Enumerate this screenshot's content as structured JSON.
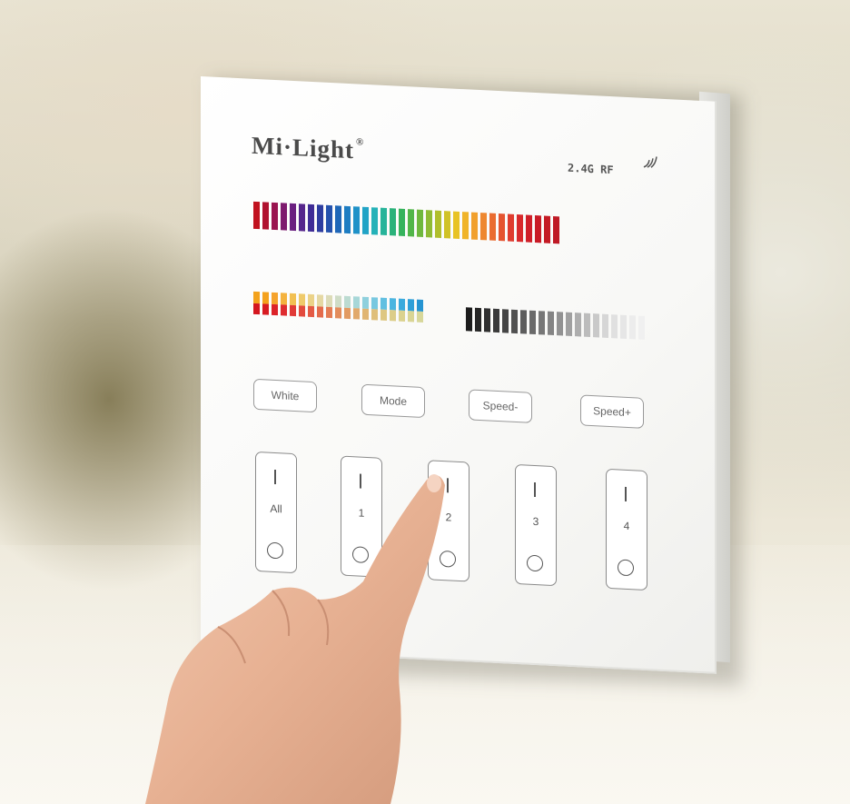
{
  "brand": {
    "name": "Mi·Light",
    "registered": "®"
  },
  "rf_label": "2.4G RF",
  "icons": {
    "rf": "wifi-signal-icon",
    "off": "circle-icon",
    "on": "bar-icon"
  },
  "rainbow_colors": [
    "#c1121f",
    "#b0122f",
    "#9a1450",
    "#7e1a6e",
    "#6a1f80",
    "#55258c",
    "#3f2c96",
    "#2e3da0",
    "#2552ad",
    "#1f67b8",
    "#1e7dc2",
    "#1f92c8",
    "#22a4c6",
    "#25b2b8",
    "#27b49a",
    "#2ab27a",
    "#35b35c",
    "#52b649",
    "#6fb83e",
    "#8fbb35",
    "#b0be2c",
    "#d0c226",
    "#e8c324",
    "#f0b42a",
    "#f1a02d",
    "#ee872f",
    "#ea6c30",
    "#e55430",
    "#df3c2f",
    "#d8292c",
    "#cf1f29",
    "#c91b26",
    "#c41a24",
    "#bf1a25"
  ],
  "warm_top": [
    "#f3a21b",
    "#f4a11d",
    "#f5a32c",
    "#f4b23e",
    "#f2c052",
    "#efca6a",
    "#ebd287",
    "#e5d8a3",
    "#dcdbb7",
    "#cfdcc6",
    "#bcdbd1",
    "#a7d7d8",
    "#8fd0dd",
    "#78c8e0",
    "#61bfe1",
    "#4bb5e0",
    "#3baadd",
    "#2f9fd8",
    "#2694d2"
  ],
  "warm_bottom": [
    "#d4161e",
    "#d81b22",
    "#dc2228",
    "#df2c2f",
    "#e13a36",
    "#e34a3d",
    "#e45a44",
    "#e46b4b",
    "#e47c53",
    "#e38c5b",
    "#e29b63",
    "#e1a96b",
    "#e0b573",
    "#dfbf7b",
    "#dec782",
    "#dccd88",
    "#dbd28e",
    "#d9d594",
    "#d7d79a"
  ],
  "gray_colors": [
    "#1c1c1c",
    "#252525",
    "#2f2f2f",
    "#3a3a3a",
    "#454545",
    "#515151",
    "#5d5d5d",
    "#6a6a6a",
    "#777777",
    "#848484",
    "#929292",
    "#a0a0a0",
    "#aeaeae",
    "#bcbcbc",
    "#c9c9c9",
    "#d6d6d6",
    "#e0e0e0",
    "#e6e6e6",
    "#ececec",
    "#f0f0f0"
  ],
  "buttons": [
    "White",
    "Mode",
    "Speed-",
    "Speed+"
  ],
  "zones": [
    "All",
    "1",
    "2",
    "3",
    "4"
  ]
}
